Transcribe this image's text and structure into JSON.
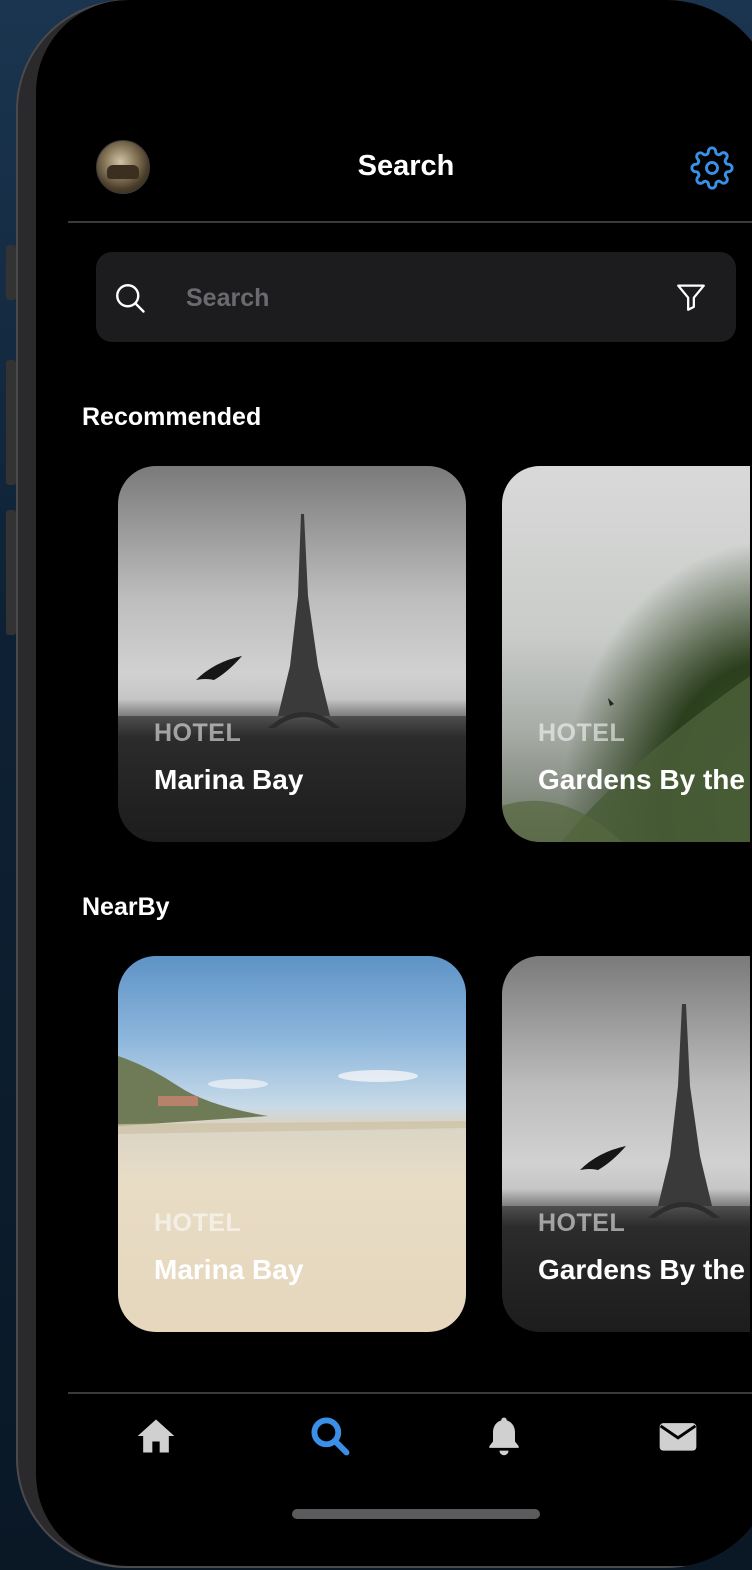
{
  "header": {
    "title": "Search",
    "avatar_icon": "user-avatar",
    "settings_icon": "gear-icon"
  },
  "search": {
    "placeholder": "Search",
    "value": "",
    "search_icon": "search-icon",
    "filter_icon": "filter-icon"
  },
  "sections": {
    "recommended": {
      "title": "Recommended",
      "cards": [
        {
          "type": "HOTEL",
          "name": "Marina Bay"
        },
        {
          "type": "HOTEL",
          "name": "Gardens By the"
        }
      ]
    },
    "nearby": {
      "title": "NearBy",
      "cards": [
        {
          "type": "HOTEL",
          "name": "Marina Bay"
        },
        {
          "type": "HOTEL",
          "name": "Gardens By the"
        }
      ]
    }
  },
  "tabbar": {
    "items": [
      {
        "icon": "home-icon",
        "active": false
      },
      {
        "icon": "search-icon",
        "active": true
      },
      {
        "icon": "bell-icon",
        "active": false
      },
      {
        "icon": "envelope-icon",
        "active": false
      }
    ]
  },
  "colors": {
    "accent": "#3b8fe6",
    "background": "#000000",
    "surface": "#1c1c1e",
    "icon_inactive": "#d0d0d0"
  }
}
